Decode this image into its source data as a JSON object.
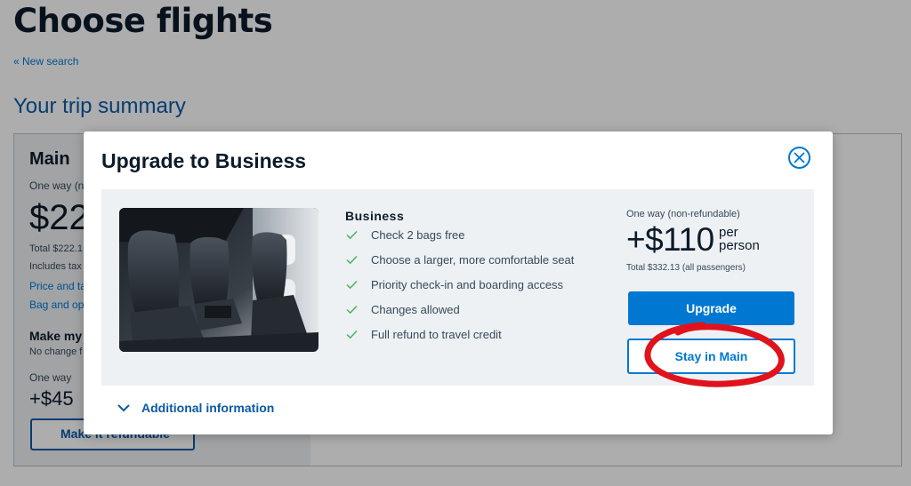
{
  "page": {
    "title": "Choose flights",
    "new_search_link": "« New search",
    "trip_summary_heading": "Your trip summary"
  },
  "summary_card": {
    "fare_name": "Main",
    "one_way": "One way (n",
    "price": "$22",
    "total": "Total $222.1",
    "includes": "Includes tax",
    "link_price": "Price and ta",
    "link_bag": "Bag and op",
    "make_refundable_heading": "Make my",
    "no_change": "No change f",
    "one_way_2": "One way",
    "refund_price": "+$45",
    "refund_button": "Make it refundable"
  },
  "modal": {
    "title": "Upgrade to Business",
    "close_label": "close",
    "benefits_title": "Business",
    "benefits": [
      "Check 2 bags free",
      "Choose a larger, more comfortable seat",
      "Priority check-in and boarding access",
      "Changes allowed",
      "Full refund to travel credit"
    ],
    "one_way_label": "One way (non-refundable)",
    "price": "+$110",
    "per_label_1": "per",
    "per_label_2": "person",
    "total_label": "Total $332.13 (all passengers)",
    "upgrade_button": "Upgrade",
    "stay_button": "Stay in Main",
    "additional_info": "Additional information"
  },
  "colors": {
    "brand_blue": "#0078d2",
    "dark_blue": "#0b5aa5",
    "check_green": "#4db35e",
    "annotation_red": "#e0121b"
  },
  "icons": {
    "close": "close-circle-icon",
    "check": "check-icon",
    "chevron": "chevron-down-icon"
  }
}
